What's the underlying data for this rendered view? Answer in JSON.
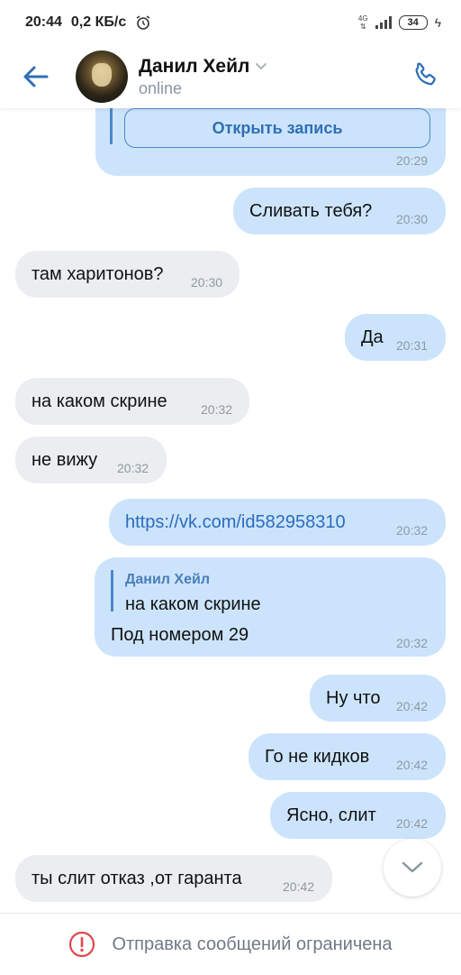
{
  "status_bar": {
    "time": "20:44",
    "speed": "0,2 КБ/с",
    "network_top": "4G",
    "network_bottom": "⇅",
    "battery": "34"
  },
  "header": {
    "contact_name": "Данил Хейл",
    "presence": "online"
  },
  "messages": [
    {
      "dir": "out",
      "kind": "post",
      "button_label": "Открыть запись",
      "time": "20:29"
    },
    {
      "dir": "out",
      "text": "Сливать тебя?",
      "time": "20:30"
    },
    {
      "dir": "in",
      "text": "там харитонов?",
      "time": "20:30"
    },
    {
      "dir": "out",
      "text": "Да",
      "time": "20:31"
    },
    {
      "dir": "in",
      "text": "на каком скрине",
      "time": "20:32"
    },
    {
      "dir": "in",
      "text": "не вижу",
      "time": "20:32"
    },
    {
      "dir": "out",
      "kind": "link",
      "text": "https://vk.com/id582958310",
      "time": "20:32"
    },
    {
      "dir": "out",
      "kind": "reply",
      "quote_author": "Данил Хейл",
      "quote_text": "на каком скрине",
      "text": "Под номером 29",
      "time": "20:32"
    },
    {
      "dir": "out",
      "text": "Ну что",
      "time": "20:42"
    },
    {
      "dir": "out",
      "text": "Го не кидков",
      "time": "20:42"
    },
    {
      "dir": "out",
      "text": "Ясно, слит",
      "time": "20:42"
    },
    {
      "dir": "in",
      "text": "ты слит отказ ,от гаранта",
      "time": "20:42"
    }
  ],
  "footer": {
    "restriction_text": "Отправка сообщений ограничена"
  },
  "colors": {
    "accent": "#2f6fb5",
    "outgoing_bubble": "#cce4fb",
    "incoming_bubble": "#ebedf0",
    "warning": "#e0484d"
  }
}
